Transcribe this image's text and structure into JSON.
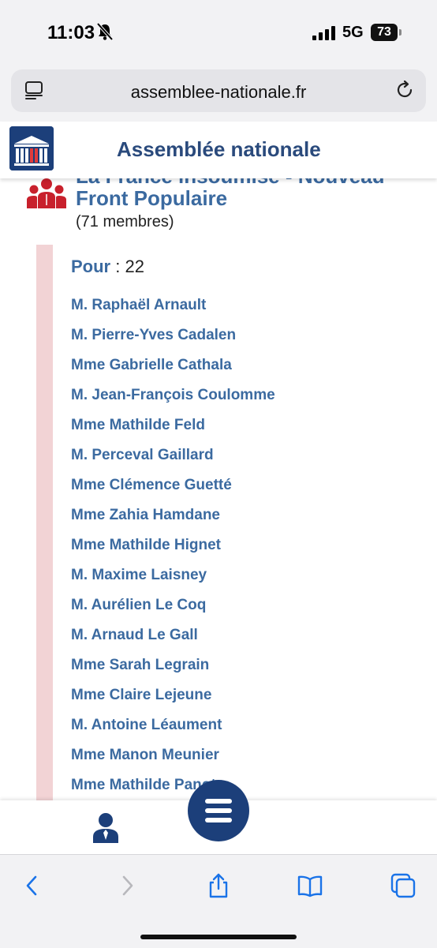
{
  "status_bar": {
    "time": "11:03",
    "network": "5G",
    "battery": "73"
  },
  "url_bar": {
    "url": "assemblee-nationale.fr"
  },
  "site": {
    "title": "Assemblée nationale"
  },
  "group": {
    "name_partial_hidden": "La France insoumise - Nouveau",
    "name_line2": "Front Populaire",
    "members": "(71 membres)"
  },
  "vote": {
    "label": "Pour",
    "separator": " : ",
    "count": "22",
    "names": [
      "M. Raphaël Arnault",
      "M. Pierre-Yves Cadalen",
      "Mme Gabrielle Cathala",
      "M. Jean-François Coulomme",
      "Mme Mathilde Feld",
      "M. Perceval Gaillard",
      "Mme Clémence Guetté",
      "Mme Zahia Hamdane",
      "Mme Mathilde Hignet",
      "M. Maxime Laisney",
      "M. Aurélien Le Coq",
      "M. Arnaud Le Gall",
      "Mme Sarah Legrain",
      "Mme Claire Lejeune",
      "M. Antoine Léaument",
      "Mme Manon Meunier",
      "Mme Mathilde Panot"
    ]
  },
  "icons": {
    "bell": "bell-slash-icon",
    "reader": "reader-icon",
    "reload": "reload-icon",
    "group": "group-icon",
    "user": "user-icon",
    "menu": "hamburger-menu-icon",
    "back": "chevron-left-icon",
    "forward": "chevron-right-icon",
    "share": "share-icon",
    "bookmarks": "book-icon",
    "tabs": "tabs-icon"
  },
  "colors": {
    "primary": "#1c3f7a",
    "link": "#3b6aa0",
    "side_bar": "#f2d3d5",
    "group_icon": "#c8202c",
    "ios_blue": "#1a73e8"
  }
}
